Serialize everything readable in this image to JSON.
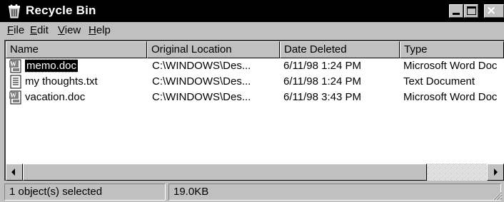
{
  "window": {
    "title": "Recycle Bin",
    "icon": "recycle-bin-icon",
    "controls": [
      "minimize-icon",
      "maximize-icon",
      "close-icon"
    ]
  },
  "menu": {
    "items": [
      {
        "first": "F",
        "rest": "ile"
      },
      {
        "first": "E",
        "rest": "dit"
      },
      {
        "first": "V",
        "rest": "iew"
      },
      {
        "first": "H",
        "rest": "elp"
      }
    ]
  },
  "list": {
    "columns": [
      "Name",
      "Original Location",
      "Date Deleted",
      "Type"
    ],
    "rows": [
      {
        "name": "memo.doc",
        "location": "C:\\WINDOWS\\Des...",
        "date": "6/11/98 1:24 PM",
        "type": "Microsoft Word Doc",
        "icon": "word-document-icon",
        "selected": true
      },
      {
        "name": "my thoughts.txt",
        "location": "C:\\WINDOWS\\Des...",
        "date": "6/11/98 1:24 PM",
        "type": "Text Document",
        "icon": "text-document-icon",
        "selected": false
      },
      {
        "name": "vacation.doc",
        "location": "C:\\WINDOWS\\Des...",
        "date": "6/11/98 3:43 PM",
        "type": "Microsoft Word Doc",
        "icon": "word-document-icon",
        "selected": false
      }
    ]
  },
  "status": {
    "selection": "1 object(s) selected",
    "size": "19.0KB"
  },
  "colors": {
    "titlebar": "#000000",
    "face": "#c0c0c0",
    "selection": "#000000"
  }
}
